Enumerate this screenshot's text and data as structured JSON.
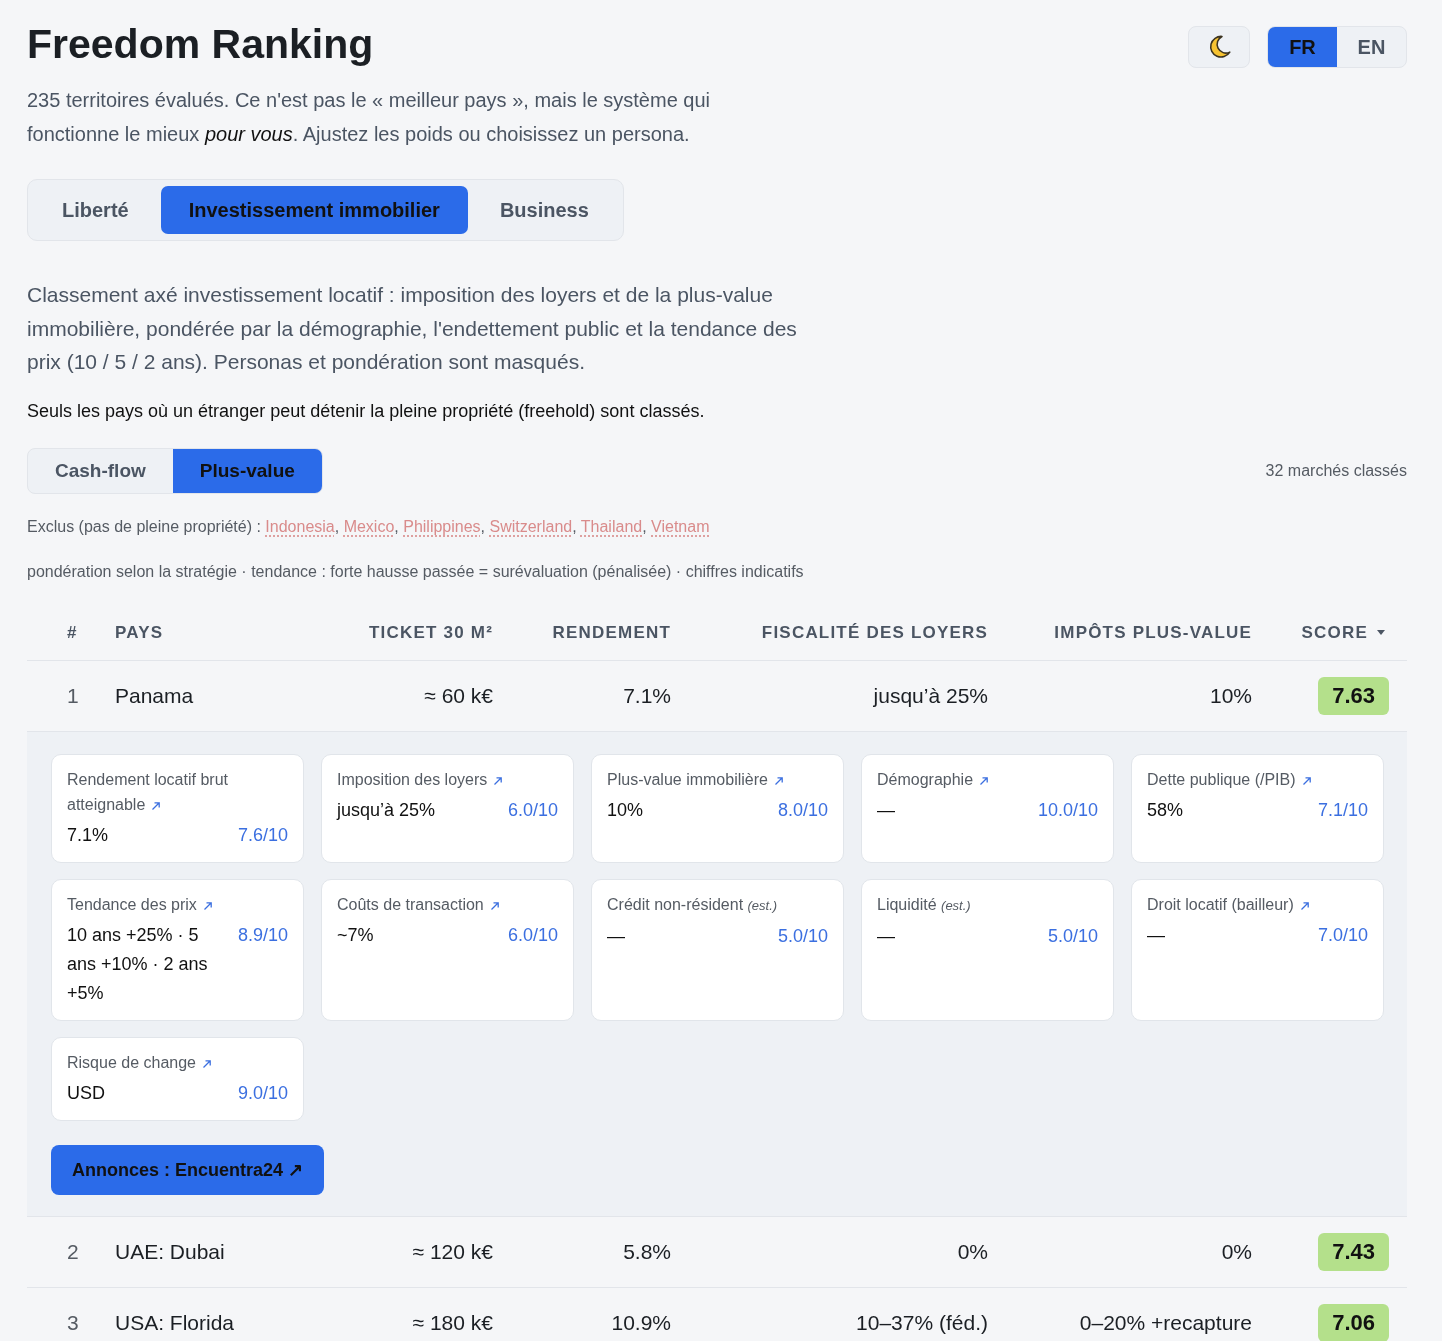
{
  "header": {
    "title": "Freedom Ranking",
    "subtitle": "235 territoires évalués. Ce n'est pas le « meilleur pays », mais le système qui fonctionne le mieux *pour vous*. Ajustez les poids ou choisissez un persona."
  },
  "language_toggle": [
    {
      "label": "FR",
      "selected": true
    },
    {
      "label": "EN",
      "selected": false
    }
  ],
  "tabs": [
    {
      "label": "Liberté",
      "selected": false
    },
    {
      "label": "Investissement immobilier",
      "selected": true
    },
    {
      "label": "Business",
      "selected": false
    }
  ],
  "description": "Classement axé investissement locatif : imposition des loyers et de la plus-value immobilière, pondérée par la démographie, l'endettement public et la tendance des prix (10 / 5 / 2 ans). Personas et pondération sont masqués.",
  "note": "Seuls les pays où un étranger peut détenir la pleine propriété (freehold) sont classés.",
  "strategy_toggle": [
    {
      "label": "Cash-flow",
      "selected": false
    },
    {
      "label": "Plus-value",
      "selected": true
    }
  ],
  "count": "32 marchés classés",
  "excluded": {
    "label": "Exclus (pas de pleine propriété) :",
    "separator": ",",
    "countries": [
      "Indonesia",
      "Mexico",
      "Philippines",
      "Switzerland",
      "Thailand",
      "Vietnam"
    ]
  },
  "legend": "pondération selon la stratégie · tendance : forte hausse passée = surévaluation (pénalisée) · chiffres indicatifs",
  "table": {
    "columns": [
      {
        "label": "#",
        "sorted": false
      },
      {
        "label": "PAYS",
        "sorted": false
      },
      {
        "label": "TICKET 30 M²",
        "sorted": false
      },
      {
        "label": "RENDEMENT",
        "sorted": false
      },
      {
        "label": "FISCALITÉ DES LOYERS",
        "sorted": false
      },
      {
        "label": "IMPÔTS PLUS-VALUE",
        "sorted": false
      },
      {
        "label": "SCORE",
        "sorted": true
      }
    ],
    "rows": [
      {
        "rank": "1",
        "country": "Panama",
        "ticket": "≈ 60 k€",
        "yield": "7.1%",
        "rent_tax": "jusqu’à 25%",
        "capital_gains_tax": "10%",
        "score": "7.63",
        "expanded": true,
        "details": {
          "metrics": [
            {
              "label": "Rendement locatif brut atteignable",
              "linked": true,
              "value": "7.1%",
              "score": "7.6/10"
            },
            {
              "label": "Imposition des loyers",
              "linked": true,
              "value": "jusqu’à 25%",
              "score": "6.0/10"
            },
            {
              "label": "Plus-value immobilière",
              "linked": true,
              "value": "10%",
              "score": "8.0/10"
            },
            {
              "label": "Démographie",
              "linked": true,
              "value": "—",
              "score": "10.0/10"
            },
            {
              "label": "Dette publique (/PIB)",
              "linked": true,
              "value": "58%",
              "score": "7.1/10"
            },
            {
              "label": "Tendance des prix",
              "linked": true,
              "value": "10 ans +25% · 5 ans +10% · 2 ans +5%",
              "score": "8.9/10"
            },
            {
              "label": "Coûts de transaction",
              "linked": true,
              "value": "~7%",
              "score": "6.0/10"
            },
            {
              "label": "Crédit non-résident *(est.)*",
              "linked": false,
              "value": "—",
              "score": "5.0/10"
            },
            {
              "label": "Liquidité *(est.)*",
              "linked": false,
              "value": "—",
              "score": "5.0/10"
            },
            {
              "label": "Droit locatif (bailleur)",
              "linked": true,
              "value": "—",
              "score": "7.0/10"
            },
            {
              "label": "Risque de change",
              "linked": true,
              "value": "USD",
              "score": "9.0/10"
            }
          ],
          "listings_button": "Annonces : Encuentra24 ↗"
        }
      },
      {
        "rank": "2",
        "country": "UAE: Dubai",
        "ticket": "≈ 120 k€",
        "yield": "5.8%",
        "rent_tax": "0%",
        "capital_gains_tax": "0%",
        "score": "7.43",
        "expanded": false
      },
      {
        "rank": "3",
        "country": "USA: Florida",
        "ticket": "≈ 180 k€",
        "yield": "10.9%",
        "rent_tax": "10–37% (féd.)",
        "capital_gains_tax": "0–20% +recapture",
        "score": "7.06",
        "expanded": false
      }
    ]
  }
}
